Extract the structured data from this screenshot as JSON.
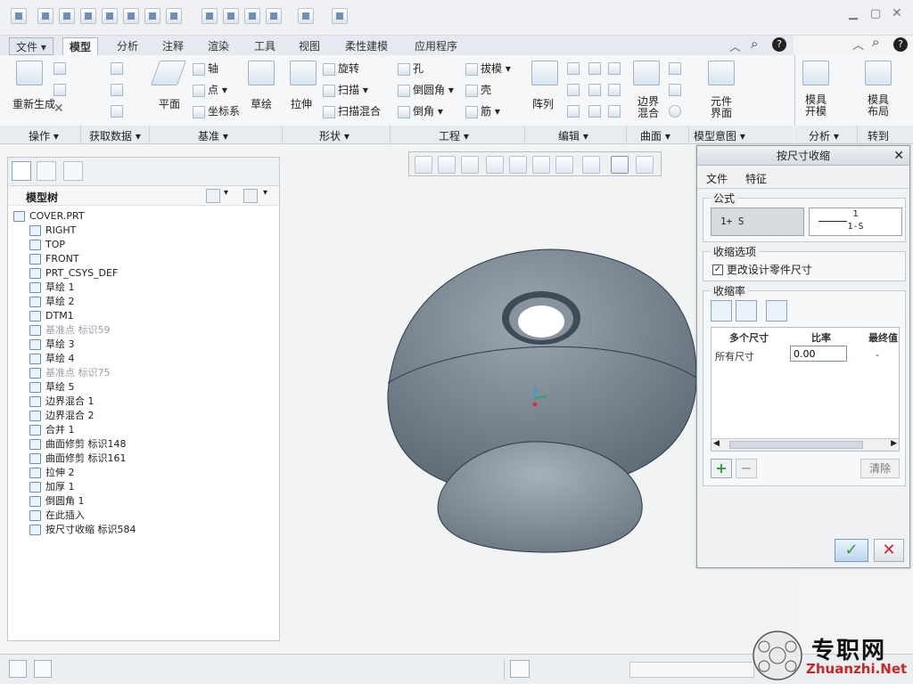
{
  "ribbon": {
    "tabs": [
      "文件",
      "模型",
      "分析",
      "注释",
      "渲染",
      "工具",
      "视图",
      "柔性建模",
      "应用程序"
    ],
    "active_tab": "模型",
    "items": {
      "regenerate": "重新生成",
      "axis": "轴",
      "point": "点",
      "csys": "坐标系",
      "plane": "平面",
      "sketch": "草绘",
      "extrude": "拉伸",
      "revolve": "旋转",
      "sweep": "扫描",
      "swept_blend": "扫描混合",
      "hole": "孔",
      "round": "倒圆角",
      "chamfer": "倒角",
      "draft": "拔模",
      "shell": "壳",
      "rib": "筋",
      "pattern": "阵列",
      "boundary_blend": "边界混合",
      "component_interface": "元件界面",
      "mold_open": "模具开模",
      "mold_layout": "模具布局"
    },
    "groups": [
      "操作",
      "获取数据",
      "基准",
      "形状",
      "工程",
      "编辑",
      "曲面",
      "模型意图",
      "分析",
      "转到"
    ]
  },
  "model_tree": {
    "title": "模型树",
    "nodes": [
      {
        "label": "COVER.PRT",
        "dim": false,
        "indent": 0
      },
      {
        "label": "RIGHT",
        "dim": false,
        "indent": 1
      },
      {
        "label": "TOP",
        "dim": false,
        "indent": 1
      },
      {
        "label": "FRONT",
        "dim": false,
        "indent": 1
      },
      {
        "label": "PRT_CSYS_DEF",
        "dim": false,
        "indent": 1
      },
      {
        "label": "草绘 1",
        "dim": false,
        "indent": 1
      },
      {
        "label": "草绘 2",
        "dim": false,
        "indent": 1
      },
      {
        "label": "DTM1",
        "dim": false,
        "indent": 1
      },
      {
        "label": "基准点 标识59",
        "dim": true,
        "indent": 1
      },
      {
        "label": "草绘 3",
        "dim": false,
        "indent": 1
      },
      {
        "label": "草绘 4",
        "dim": false,
        "indent": 1
      },
      {
        "label": "基准点 标识75",
        "dim": true,
        "indent": 1
      },
      {
        "label": "草绘 5",
        "dim": false,
        "indent": 1
      },
      {
        "label": "边界混合 1",
        "dim": false,
        "indent": 1
      },
      {
        "label": "边界混合 2",
        "dim": false,
        "indent": 1
      },
      {
        "label": "合并 1",
        "dim": false,
        "indent": 1
      },
      {
        "label": "曲面修剪 标识148",
        "dim": false,
        "indent": 1
      },
      {
        "label": "曲面修剪 标识161",
        "dim": false,
        "indent": 1
      },
      {
        "label": "拉伸 2",
        "dim": false,
        "indent": 1
      },
      {
        "label": "加厚 1",
        "dim": false,
        "indent": 1
      },
      {
        "label": "倒圆角 1",
        "dim": false,
        "indent": 1
      },
      {
        "label": "在此插入",
        "dim": false,
        "indent": 1
      },
      {
        "label": "按尺寸收缩 标识584",
        "dim": false,
        "indent": 1
      }
    ]
  },
  "dialog": {
    "title": "按尺寸收缩",
    "menus": [
      "文件",
      "特征"
    ],
    "formula_section": "公式",
    "formula_1": "1+ S",
    "formula_2_num": "1",
    "formula_2_den": "1-S",
    "options_section": "收缩选项",
    "option_checkbox": "更改设计零件尺寸",
    "ratio_section": "收缩率",
    "table": {
      "headers": [
        "多个尺寸",
        "比率",
        "最终值"
      ],
      "row_label": "所有尺寸",
      "ratio_value": "0.00",
      "final_value": "-"
    },
    "clear_label": "清除"
  },
  "watermark": {
    "cn": "专职网",
    "en": "Zhuanzhi.Net"
  },
  "colors": {
    "accent": "#2a6db0",
    "ok_button": "#2e9d3a",
    "cancel_button": "#c62828",
    "model_fill": "#7e8b97"
  }
}
